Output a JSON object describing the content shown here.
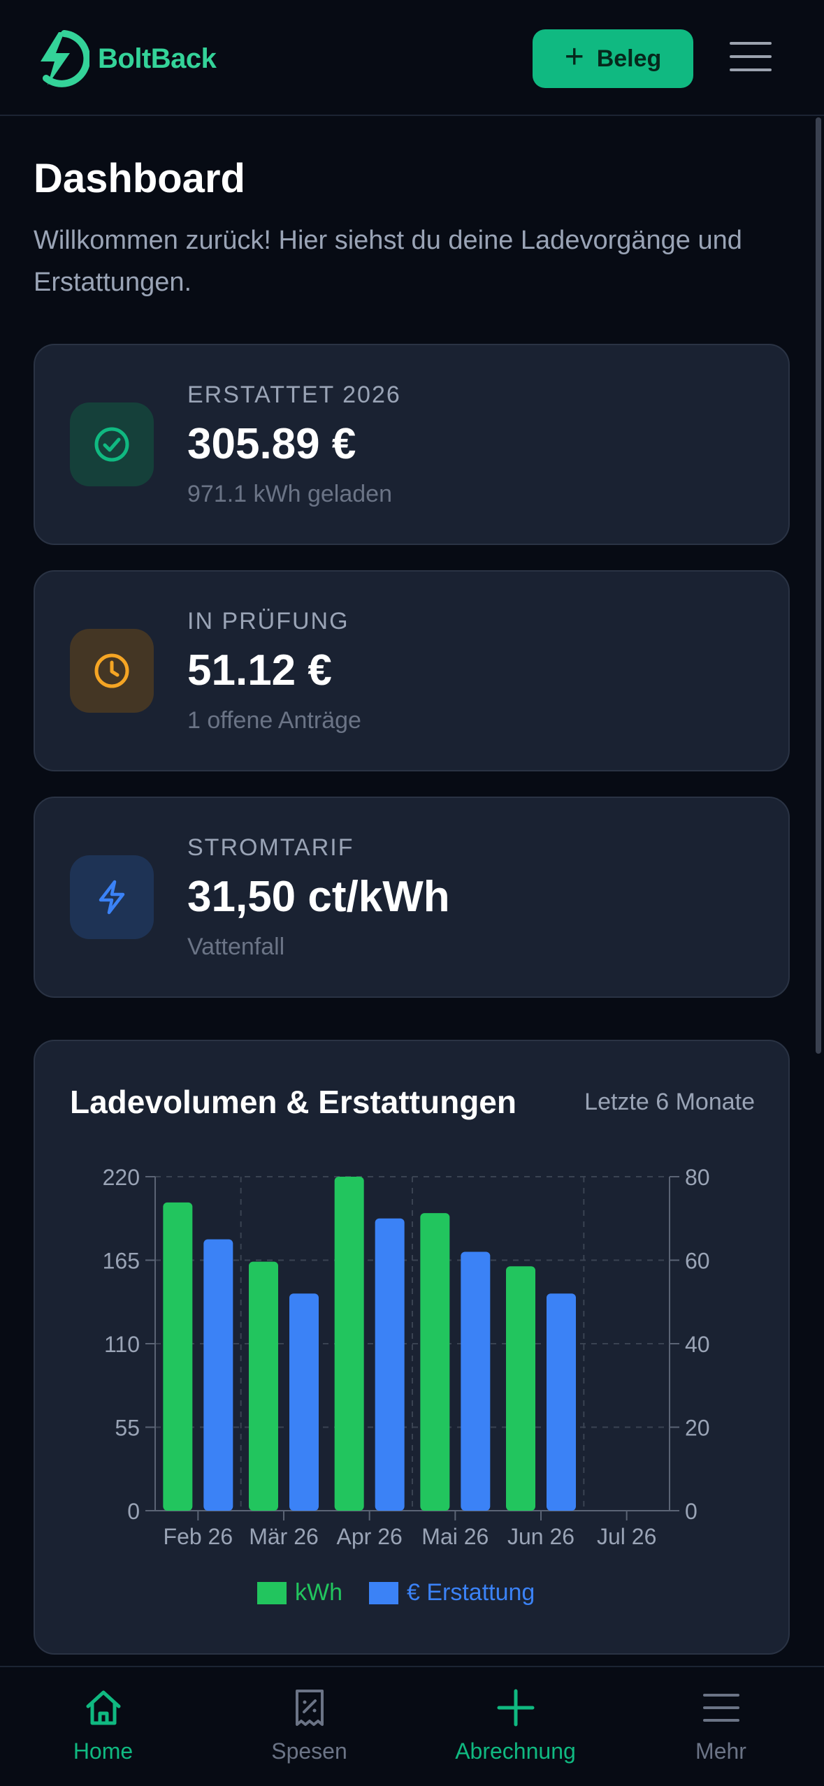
{
  "header": {
    "brand": "BoltBack",
    "primary_button": "Beleg"
  },
  "page": {
    "title": "Dashboard",
    "subtitle": "Willkommen zurück! Hier siehst du deine Ladevorgänge und Erstattungen."
  },
  "cards": [
    {
      "label": "ERSTATTET 2026",
      "value": "305.89 €",
      "sub": "971.1 kWh geladen",
      "icon": "check-circle-icon",
      "color": "#10b981"
    },
    {
      "label": "IN PRÜFUNG",
      "value": "51.12 €",
      "sub": "1 offene Anträge",
      "icon": "clock-icon",
      "color": "#f59e0b"
    },
    {
      "label": "STROMTARIF",
      "value": "31,50 ct/kWh",
      "sub": "Vattenfall",
      "icon": "lightning-icon",
      "color": "#3b82f6"
    }
  ],
  "chart": {
    "title": "Ladevolumen & Erstattungen",
    "range_label": "Letzte 6 Monate"
  },
  "chart_data": {
    "type": "bar",
    "categories": [
      "Feb 26",
      "Mär 26",
      "Apr 26",
      "Mai 26",
      "Jun 26",
      "Jul 26"
    ],
    "series": [
      {
        "name": "kWh",
        "axis": "left",
        "color": "#22c55e",
        "values": [
          203,
          164,
          220,
          196,
          161,
          null
        ]
      },
      {
        "name": "€ Erstattung",
        "axis": "right",
        "color": "#3b82f6",
        "values": [
          65,
          52,
          70,
          62,
          52,
          null
        ]
      }
    ],
    "y_left": {
      "ticks": [
        "220",
        "165",
        "110",
        "55",
        "0"
      ],
      "ylim": [
        0,
        220
      ]
    },
    "y_right": {
      "ticks": [
        "80",
        "60",
        "40",
        "20",
        "0"
      ],
      "ylim": [
        0,
        80
      ]
    },
    "legend_position": "bottom",
    "grid": true
  },
  "nav": [
    {
      "label": "Home",
      "icon": "home-icon",
      "active": true
    },
    {
      "label": "Spesen",
      "icon": "receipt-icon",
      "active": false
    },
    {
      "label": "Abrechnung",
      "icon": "plus-icon",
      "active": true
    },
    {
      "label": "Mehr",
      "icon": "menu-icon",
      "active": false
    }
  ]
}
